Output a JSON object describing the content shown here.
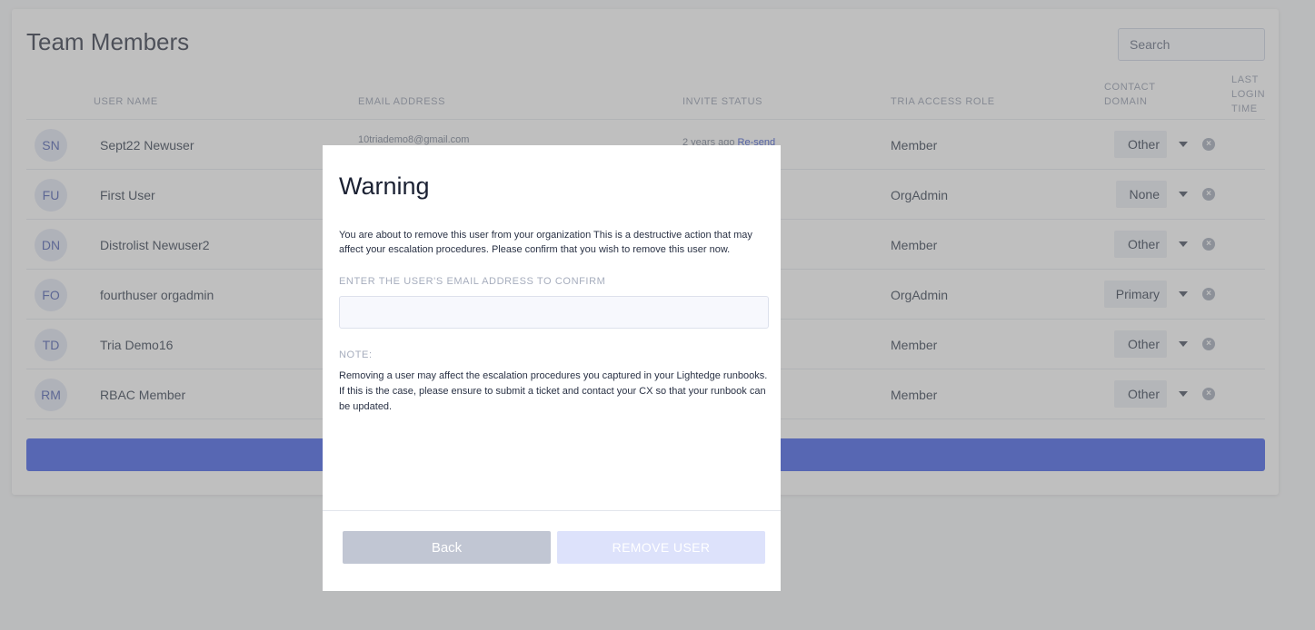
{
  "page": {
    "title": "Team Members",
    "search_placeholder": "Search"
  },
  "table": {
    "headers": {
      "user_name": "USER NAME",
      "email": "EMAIL ADDRESS",
      "invite_status": "INVITE STATUS",
      "role": "TRIA ACCESS ROLE",
      "contact_domain": "CONTACT DOMAIN",
      "last_login": "LAST LOGIN TIME"
    },
    "rows": [
      {
        "initials": "SN",
        "name": "Sept22 Newuser",
        "email": "10triademo8@gmail.com",
        "invite_status": "2 years ago",
        "resend": "Re-send",
        "role": "Member",
        "domain": "Other"
      },
      {
        "initials": "FU",
        "name": "First User",
        "role": "OrgAdmin",
        "domain": "None"
      },
      {
        "initials": "DN",
        "name": "Distrolist Newuser2",
        "role": "Member",
        "domain": "Other"
      },
      {
        "initials": "FO",
        "name": "fourthuser orgadmin",
        "role": "OrgAdmin",
        "domain": "Primary"
      },
      {
        "initials": "TD",
        "name": "Tria Demo16",
        "role": "Member",
        "domain": "Other"
      },
      {
        "initials": "RM",
        "name": "RBAC Member",
        "role": "Member",
        "domain": "Other"
      }
    ]
  },
  "modal": {
    "title": "Warning",
    "message": "You are about to remove this user from your organization This is a destructive action that may affect your escalation procedures. Please confirm that you wish to remove this user now.",
    "confirm_label": "ENTER THE USER'S EMAIL ADDRESS TO CONFIRM",
    "confirm_value": "",
    "note_label": "NOTE:",
    "note_text": "Removing a user may affect the escalation procedures you captured in your Lightedge runbooks. If this is the case, please ensure to submit a ticket and contact your CX so that your runbook can be updated.",
    "back_label": "Back",
    "remove_label": "REMOVE USER"
  },
  "colors": {
    "accent": "#2f4ee6",
    "overlay": "#808080",
    "remove_button_disabled": "#dde2fb",
    "back_button": "#c1c6d3"
  },
  "icons": [
    "caret-down-icon",
    "remove-user-icon"
  ]
}
